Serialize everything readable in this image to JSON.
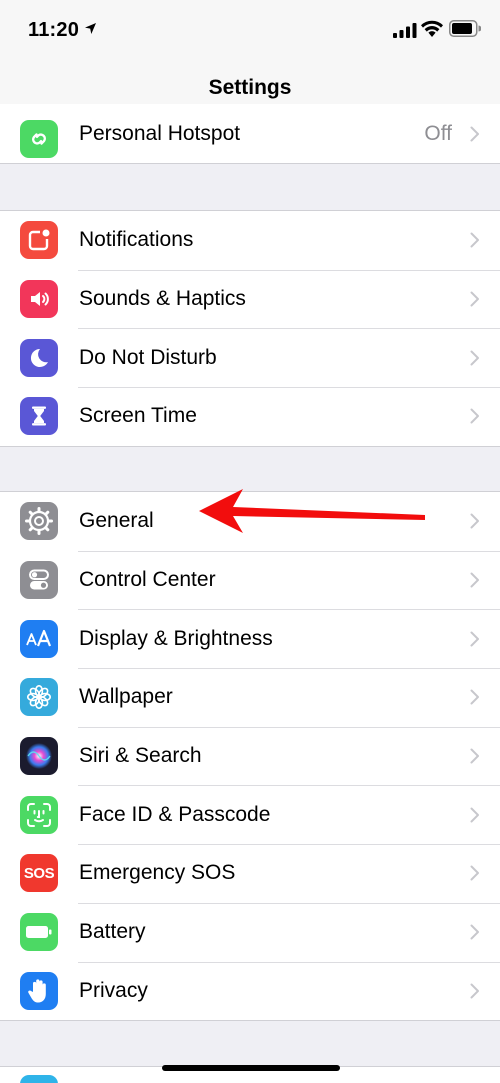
{
  "status_bar": {
    "time": "11:20"
  },
  "nav": {
    "title": "Settings"
  },
  "groups": {
    "connectivity": [
      {
        "label": "Personal Hotspot",
        "value": "Off",
        "icon": "hotspot-icon",
        "color": "#4cd964"
      }
    ],
    "alerts": [
      {
        "label": "Notifications",
        "icon": "notifications-icon",
        "color": "#f44a3e"
      },
      {
        "label": "Sounds & Haptics",
        "icon": "speaker-icon",
        "color": "#f2365a"
      },
      {
        "label": "Do Not Disturb",
        "icon": "moon-icon",
        "color": "#5a57d6"
      },
      {
        "label": "Screen Time",
        "icon": "hourglass-icon",
        "color": "#5a57d6"
      }
    ],
    "system": [
      {
        "label": "General",
        "icon": "gear-icon",
        "color": "#8e8e93"
      },
      {
        "label": "Control Center",
        "icon": "toggles-icon",
        "color": "#8e8e93"
      },
      {
        "label": "Display & Brightness",
        "icon": "text-size-icon",
        "color": "#1f7ef2"
      },
      {
        "label": "Wallpaper",
        "icon": "flower-icon",
        "color": "#35aadc"
      },
      {
        "label": "Siri & Search",
        "icon": "siri-icon",
        "color": "#1b1b2e"
      },
      {
        "label": "Face ID & Passcode",
        "icon": "face-id-icon",
        "color": "#4cd964"
      },
      {
        "label": "Emergency SOS",
        "icon": "sos-icon",
        "text": "SOS",
        "color": "#f0382e"
      },
      {
        "label": "Battery",
        "icon": "battery-icon",
        "color": "#4cd964"
      },
      {
        "label": "Privacy",
        "icon": "hand-icon",
        "color": "#1f7ef2"
      }
    ]
  },
  "annotation": {
    "arrow_color": "#f20d0d"
  }
}
